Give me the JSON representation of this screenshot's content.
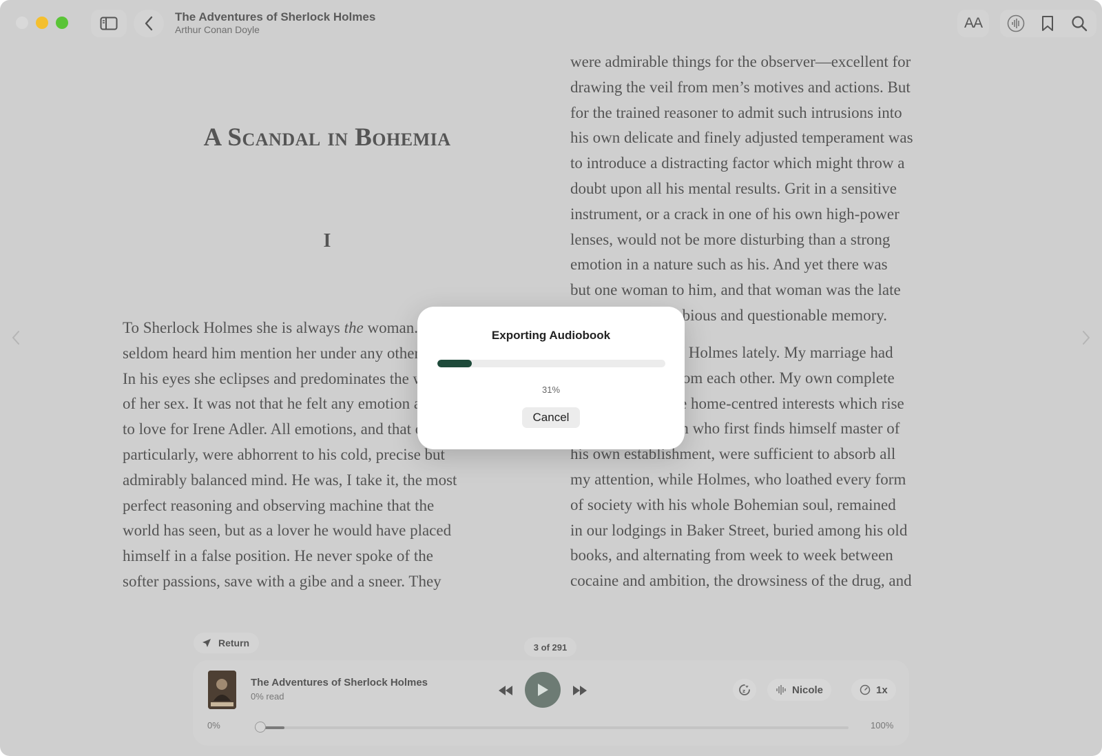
{
  "header": {
    "book_title": "The Adventures of Sherlock Holmes",
    "author": "Arthur Conan Doyle",
    "font_button_label": "AA"
  },
  "chapter": {
    "title": "A Scandal in Bohemia",
    "number": "I"
  },
  "page_left_lines": [
    "To Sherlock Holmes she is always the woman. I have",
    "seldom heard him mention her under any other name.",
    "In his eyes she eclipses and predominates the whole",
    "of her sex. It was not that he felt any emotion akin",
    "to love for Irene Adler. All emotions, and that one",
    "particularly, were abhorrent to his cold, precise but",
    "admirably balanced mind. He was, I take it, the most",
    "perfect reasoning and observing machine that the",
    "world has seen, but as a lover he would have placed",
    "himself in a false position. He never spoke of the",
    "softer passions, save with a gibe and a sneer. They"
  ],
  "page_right_lines": [
    "were admirable things for the observer—excellent for",
    "drawing the veil from men’s motives and actions. But",
    "for the trained reasoner to admit such intrusions into",
    "his own delicate and finely adjusted temperament was",
    "to introduce a distracting factor which might throw a",
    "doubt upon all his mental results. Grit in a sensitive",
    "instrument, or a crack in one of his own high-power",
    "lenses, would not be more disturbing than a strong",
    "emotion in a nature such as his. And yet there was",
    "but one woman to him, and that woman was the late",
    "Irene Adler, of dubious and questionable memory."
  ],
  "page_right_lines_2": [
    "I had seen little of Holmes lately. My marriage had",
    "drifted us away from each other. My own complete",
    "happiness, and the home-centred interests which rise",
    "up around the man who first finds himself master of",
    "his own establishment, were sufficient to absorb all",
    "my attention, while Holmes, who loathed every form",
    "of society with his whole Bohemian soul, remained",
    "in our lodgings in Baker Street, buried among his old",
    "books, and alternating from week to week between",
    "cocaine and ambition, the drowsiness of the drug, and"
  ],
  "dialog": {
    "title": "Exporting Audiobook",
    "progress": 0.15,
    "percent_label": "31%",
    "cancel_label": "Cancel"
  },
  "player": {
    "return_label": "Return",
    "page_indicator": "3 of 291",
    "title": "The Adventures of Sherlock Holmes",
    "subtitle": "0% read",
    "voice": "Nicole",
    "speed": "1x",
    "start_label": "0%",
    "end_label": "100%",
    "scrub_progress": 0.05
  },
  "colors": {
    "progress_fill": "#1e4a3a",
    "play_button": "#6d7b74",
    "window_bg": "#cfcfcf"
  }
}
